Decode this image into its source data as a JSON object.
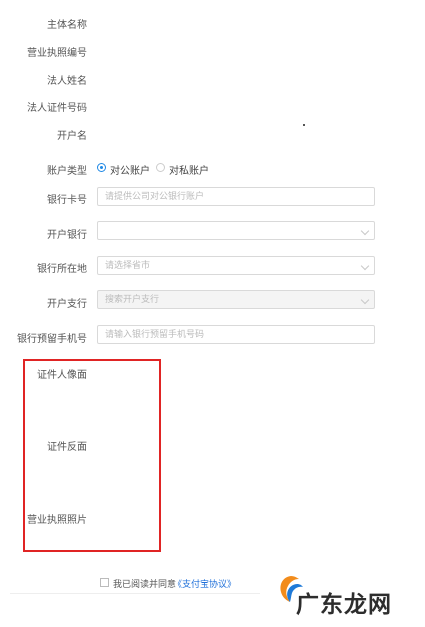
{
  "form": {
    "entity_name_label": "主体名称",
    "license_number_label": "营业执照编号",
    "legal_person_name_label": "法人姓名",
    "legal_person_id_label": "法人证件号码",
    "account_name_label": "开户名",
    "account_type_label": "账户类型",
    "account_type_options": [
      "对公账户",
      "对私账户"
    ],
    "account_type_selected": "对公账户",
    "bank_card_label": "银行卡号",
    "bank_card_placeholder": "请提供公司对公银行账户",
    "bank_label": "开户银行",
    "bank_value": "",
    "bank_location_label": "银行所在地",
    "bank_location_placeholder": "请选择省市",
    "branch_label": "开户支行",
    "branch_placeholder": "搜索开户支行",
    "phone_label": "银行预留手机号",
    "phone_placeholder": "请输入银行预留手机号码"
  },
  "uploads": {
    "id_front_label": "证件人像面",
    "id_back_label": "证件反面",
    "license_photo_label": "营业执照照片"
  },
  "agreement": {
    "text": "我已阅读并同意",
    "link_text": "《支付宝协议》"
  },
  "watermark": {
    "text": "广东龙网",
    "icon": "bird-logo-icon",
    "colors": {
      "orange": "#f28c1c",
      "blue": "#1f7ad8",
      "dark": "#2d2d2d"
    }
  },
  "colors": {
    "accent": "#1e88e5",
    "highlight_box": "#e02424",
    "link": "#1e6fd9"
  }
}
